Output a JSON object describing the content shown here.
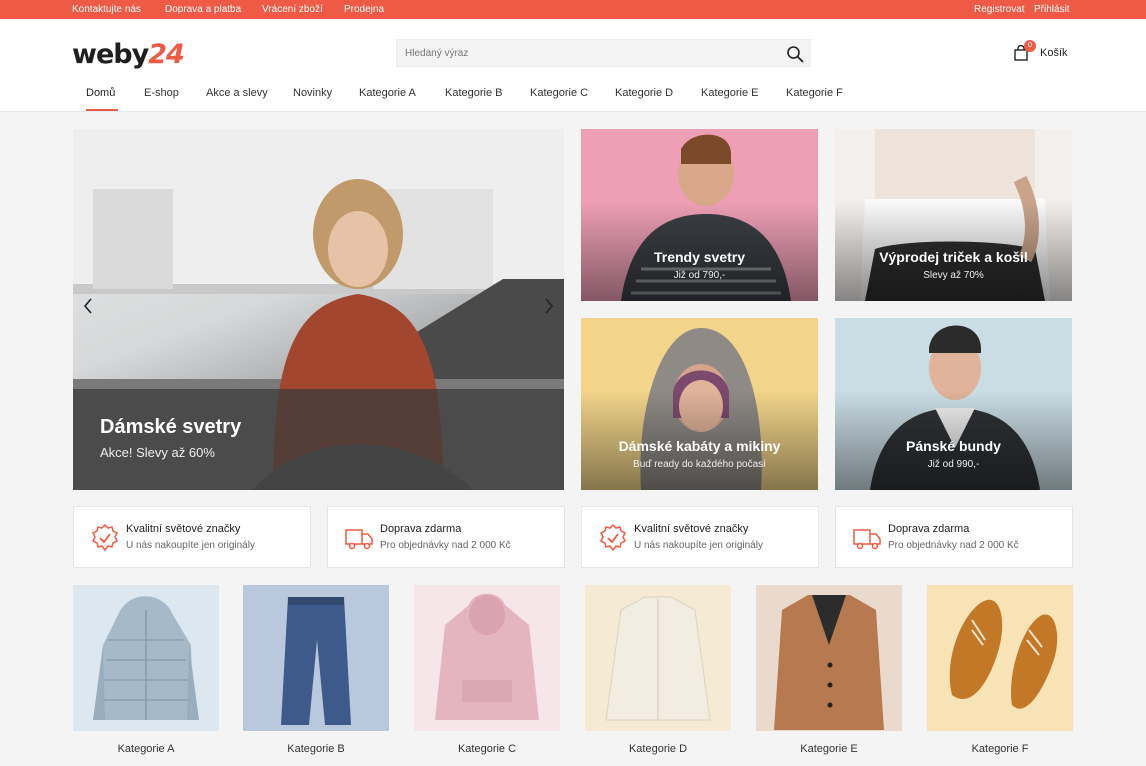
{
  "topbar": {
    "links": [
      "Kontaktujte nás",
      "Doprava a platba",
      "Vrácení zboží",
      "Prodejna"
    ],
    "right": [
      "Registrovat",
      "Přihlásit"
    ]
  },
  "header": {
    "logo_text": "weby",
    "logo_num": "24",
    "search_placeholder": "Hledaný výraz",
    "cart_count": "0",
    "cart_label": "Košík"
  },
  "nav": {
    "items": [
      "Domů",
      "E-shop",
      "Akce a slevy",
      "Novinky",
      "Kategorie A",
      "Kategorie B",
      "Kategorie C",
      "Kategorie D",
      "Kategorie E",
      "Kategorie F"
    ],
    "active": "Domů"
  },
  "hero": {
    "title": "Dámské svetry",
    "subtitle": "Akce! Slevy až 60%"
  },
  "tiles": [
    {
      "title": "Trendy svetry",
      "subtitle": "Již od 790,-"
    },
    {
      "title": "Výprodej triček a košil",
      "subtitle": "Slevy až 70%"
    },
    {
      "title": "Dámské kabáty a mikiny",
      "subtitle": "Buď ready do každého počasí"
    },
    {
      "title": "Pánské bundy",
      "subtitle": "Již od 990,-"
    }
  ],
  "features": [
    {
      "title": "Kvalitní světové značky",
      "subtitle": "U nás nakoupíte jen originály",
      "icon": "badge-check-icon"
    },
    {
      "title": "Doprava zdarma",
      "subtitle": "Pro objednávky nad 2 000 Kč",
      "icon": "truck-icon"
    },
    {
      "title": "Kvalitní světové značky",
      "subtitle": "U nás nakoupíte jen originály",
      "icon": "badge-check-icon"
    },
    {
      "title": "Doprava zdarma",
      "subtitle": "Pro objednávky nad 2 000 Kč",
      "icon": "truck-icon"
    }
  ],
  "categories": [
    "Kategorie A",
    "Kategorie B",
    "Kategorie C",
    "Kategorie D",
    "Kategorie E",
    "Kategorie F"
  ],
  "colors": {
    "accent": "#ee5a45"
  }
}
